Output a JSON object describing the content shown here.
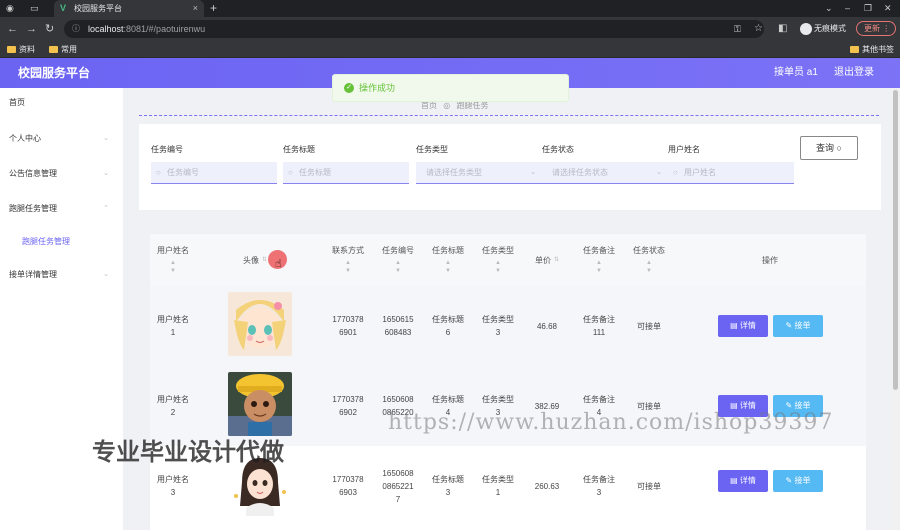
{
  "browser": {
    "tab_title": "校园服务平台",
    "tab_close": "×",
    "new_tab": "+",
    "url_host": "localhost",
    "url_rest": ":8081/#/paotuirenwu",
    "incognito": "无痕模式",
    "update": "更新",
    "bookmarks": [
      "资料",
      "常用"
    ],
    "bookmark_right": "其他书签"
  },
  "header": {
    "title": "校园服务平台",
    "user": "接单员 a1",
    "logout": "退出登录",
    "accent": "#6b64f3"
  },
  "sidebar": {
    "items": [
      {
        "label": "首页"
      },
      {
        "label": "个人中心"
      },
      {
        "label": "公告信息管理"
      },
      {
        "label": "跑腿任务管理"
      },
      {
        "label": "跑腿任务管理"
      },
      {
        "label": "接单详情管理"
      }
    ]
  },
  "toast": {
    "icon": "success-check-icon",
    "text": "操作成功"
  },
  "breadcrumb": [
    "首页",
    "跑腿任务"
  ],
  "filters": {
    "fields": [
      {
        "label": "任务编号",
        "placeholder": "任务编号"
      },
      {
        "label": "任务标题",
        "placeholder": "任务标题"
      },
      {
        "label": "任务类型",
        "placeholder": "请选择任务类型"
      },
      {
        "label": "任务状态",
        "placeholder": "请选择任务状态"
      },
      {
        "label": "用户姓名",
        "placeholder": "用户姓名"
      }
    ],
    "query_label": "查询"
  },
  "table": {
    "columns": [
      "用户姓名",
      "头像",
      "联系方式",
      "任务编号",
      "任务标题",
      "任务类型",
      "单价",
      "任务备注",
      "任务状态",
      "操作"
    ],
    "rows": [
      {
        "name": "用户姓名\n1",
        "phone": "1770378\n6901",
        "task_no": "1650615\n608483",
        "title": "任务标题\n6",
        "type": "任务类型\n3",
        "price": "46.68",
        "remark": "任务备注\n111",
        "status": "可接单"
      },
      {
        "name": "用户姓名\n2",
        "phone": "1770378\n6902",
        "task_no": "1650608\n0865220",
        "title": "任务标题\n4",
        "type": "任务类型\n3",
        "price": "382.69",
        "remark": "任务备注\n4",
        "status": "可接单"
      },
      {
        "name": "用户姓名\n3",
        "phone": "1770378\n6903",
        "task_no": "1650608\n0865221\n7",
        "title": "任务标题\n3",
        "type": "任务类型\n1",
        "price": "260.63",
        "remark": "任务备注\n3",
        "status": "可接单"
      }
    ],
    "detail_label": "详情",
    "accept_label": "接单"
  },
  "watermark": {
    "url": "https://www.huzhan.com/ishop39397",
    "cn": "专业毕业设计代做"
  }
}
